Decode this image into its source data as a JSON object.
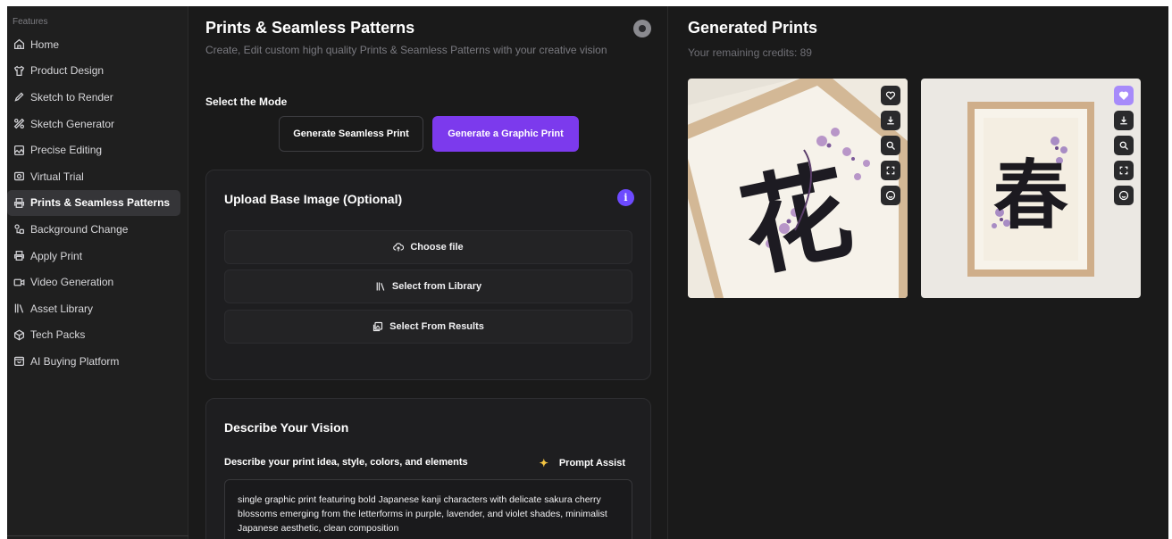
{
  "sidebar": {
    "header": "Features",
    "items": [
      {
        "label": "Home",
        "icon": "home-icon"
      },
      {
        "label": "Product Design",
        "icon": "shirt-icon"
      },
      {
        "label": "Sketch to Render",
        "icon": "pen-icon"
      },
      {
        "label": "Sketch Generator",
        "icon": "scatter-icon"
      },
      {
        "label": "Precise Editing",
        "icon": "image-edit-icon"
      },
      {
        "label": "Virtual Trial",
        "icon": "camera-icon"
      },
      {
        "label": "Prints & Seamless Patterns",
        "icon": "printer-icon",
        "active": true
      },
      {
        "label": "Background Change",
        "icon": "shapes-icon"
      },
      {
        "label": "Apply Print",
        "icon": "printer-icon"
      },
      {
        "label": "Video Generation",
        "icon": "video-icon"
      },
      {
        "label": "Asset Library",
        "icon": "library-icon"
      },
      {
        "label": "Tech Packs",
        "icon": "package-icon"
      },
      {
        "label": "AI Buying Platform",
        "icon": "bag-icon"
      }
    ]
  },
  "main": {
    "title": "Prints & Seamless Patterns",
    "subtitle": "Create, Edit custom high quality Prints & Seamless Patterns with your creative vision",
    "mode_label": "Select the Mode",
    "modes": {
      "seamless": "Generate Seamless Print",
      "graphic": "Generate a Graphic Print",
      "selected": "graphic"
    },
    "upload": {
      "title": "Upload Base Image (Optional)",
      "info": "i",
      "choose_file": "Choose file",
      "from_library": "Select from Library",
      "from_results": "Select From Results"
    },
    "vision": {
      "title": "Describe Your Vision",
      "label": "Describe your print idea, style, colors, and elements",
      "prompt_assist": "Prompt Assist",
      "prompt": "single graphic print featuring bold Japanese kanji characters with delicate sakura cherry blossoms emerging from the letterforms in purple, lavender, and violet shades, minimalist Japanese aesthetic, clean composition"
    }
  },
  "results": {
    "title": "Generated Prints",
    "credits": "Your remaining credits: 89",
    "images": [
      {
        "kanji": "花",
        "favorited": false
      },
      {
        "kanji": "春",
        "favorited": true
      }
    ],
    "tools": [
      "heart-icon",
      "download-icon",
      "search-icon",
      "expand-icon",
      "smile-icon"
    ]
  },
  "colors": {
    "accent": "#7c3aed",
    "favorite": "#a78bfa",
    "background": "#1a1a1a"
  }
}
